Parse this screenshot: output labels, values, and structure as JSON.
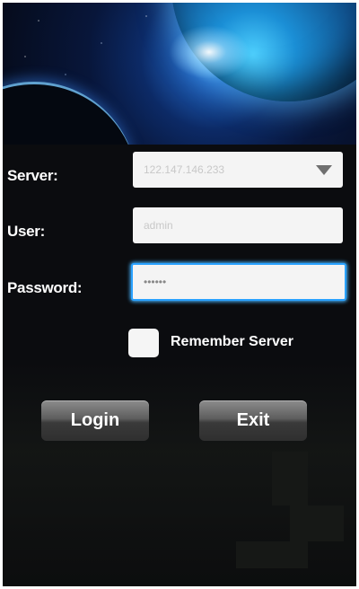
{
  "form": {
    "server_label": "Server:",
    "server_value": "122.147.146.233",
    "user_label": "User:",
    "user_value": "admin",
    "password_label": "Password:",
    "password_value": "••••••",
    "remember_label": "Remember Server",
    "remember_checked": false
  },
  "buttons": {
    "login": "Login",
    "exit": "Exit"
  },
  "icons": {
    "server_dropdown": "chevron-down-icon"
  },
  "colors": {
    "focus_accent": "#2aa2ff",
    "background": "#0b0c0f"
  }
}
